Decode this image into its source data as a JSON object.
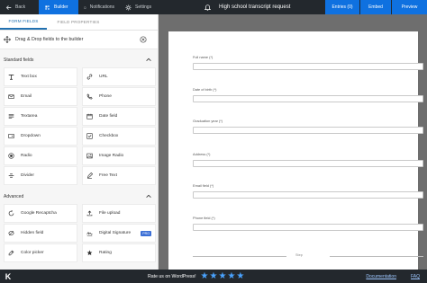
{
  "topbar": {
    "back": "Back",
    "builder": "Builder",
    "notifications": "Notifications",
    "settings": "Settings",
    "form_title": "High school transcript request",
    "entries": "Entries (0)",
    "embed": "Embed",
    "preview": "Preview"
  },
  "panel": {
    "tabs": [
      "FORM FIELDS",
      "FIELD PROPERTIES"
    ],
    "dnd_text": "Drag & Drop fields to the builder",
    "standard_title": "Standard fields",
    "standard_fields": [
      {
        "label": "Text box",
        "icon": "text-box-icon"
      },
      {
        "label": "URL",
        "icon": "link-icon"
      },
      {
        "label": "Email",
        "icon": "email-icon"
      },
      {
        "label": "Phone",
        "icon": "phone-icon"
      },
      {
        "label": "Textarea",
        "icon": "textarea-icon"
      },
      {
        "label": "Date field",
        "icon": "calendar-icon"
      },
      {
        "label": "Dropdown",
        "icon": "dropdown-icon"
      },
      {
        "label": "Checkbox",
        "icon": "checkbox-icon"
      },
      {
        "label": "Radio",
        "icon": "radio-icon"
      },
      {
        "label": "Image Radio",
        "icon": "image-radio-icon"
      },
      {
        "label": "Divider",
        "icon": "divider-icon"
      },
      {
        "label": "Free Text",
        "icon": "free-text-icon"
      }
    ],
    "advanced_title": "Advanced",
    "advanced_fields": [
      {
        "label": "Google Recaptcha",
        "icon": "recaptcha-icon"
      },
      {
        "label": "File upload",
        "icon": "upload-icon"
      },
      {
        "label": "Hidden field",
        "icon": "hidden-icon"
      },
      {
        "label": "Digital Signature",
        "icon": "signature-icon",
        "badge": "PRO"
      },
      {
        "label": "Color picker",
        "icon": "color-picker-icon"
      },
      {
        "label": "Rating",
        "icon": "star-icon"
      }
    ]
  },
  "form": {
    "fields": [
      {
        "label": "Full name (*)"
      },
      {
        "label": "Date of birth (*)"
      },
      {
        "label": "Graduation year (*)"
      },
      {
        "label": "Address (*)"
      },
      {
        "label": "Email field (*)"
      },
      {
        "label": "Phone field (*)"
      }
    ],
    "step_label": "Step"
  },
  "footer": {
    "logo": "K",
    "rate_text": "Rate us on WordPress!",
    "stars": 5,
    "documentation": "Documentation",
    "faq": "FAQ"
  },
  "colors": {
    "topbar_bg": "#23282d",
    "accent_blue": "#0f71e0",
    "canvas_bg": "#6e6e6e",
    "star_blue": "#4aa3ff",
    "pro_badge": "#3b6fd6"
  }
}
